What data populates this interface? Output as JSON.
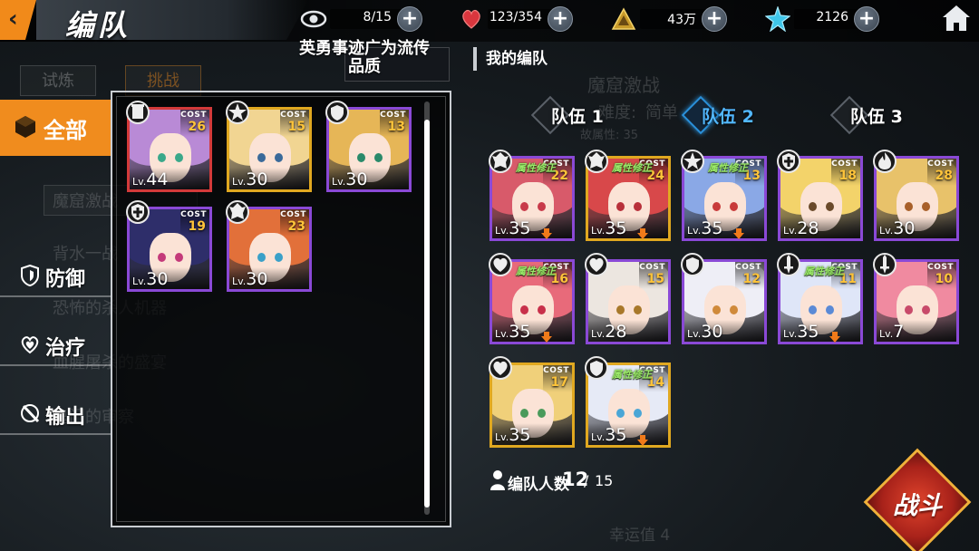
{
  "header": {
    "back_icon": "back-arrow-icon",
    "title": "编队",
    "resources": [
      {
        "icon": "eye-icon",
        "value": "8/15",
        "color": "#d8dde3"
      },
      {
        "icon": "heart-icon",
        "value": "123/354",
        "color": "#e2454e"
      },
      {
        "icon": "coin-triangle-icon",
        "value": "43万",
        "color": "#e2b437"
      },
      {
        "icon": "star-crystal-icon",
        "value": "2126",
        "color": "#4fd2f0"
      }
    ],
    "plus_label": "+",
    "home_icon": "home-icon"
  },
  "sidebar": {
    "categories": [
      {
        "label": "全部",
        "icon": "cube-icon",
        "active": true
      },
      {
        "label": "防御",
        "icon": "shield-icon",
        "active": false
      },
      {
        "label": "治疗",
        "icon": "heart-outline-icon",
        "active": false
      },
      {
        "label": "输出",
        "icon": "slash-icon",
        "active": false
      }
    ]
  },
  "background": {
    "tabs": [
      "试炼",
      "挑战"
    ],
    "items": [
      "魔窟激战",
      "背水一战",
      "恐怖的杀人机器",
      "血腥屠杀的盛宴",
      "鬼门的审察"
    ],
    "difficulty_label": "难度:",
    "difficulty_value": "简单",
    "attr_label": "故属性: 35",
    "cave_title": "魔窟激战",
    "lucky_value": "幸运值 4"
  },
  "notice": {
    "text": "英勇事迹广为流传",
    "quality_label": "品质"
  },
  "roster": {
    "cards": [
      {
        "name": "roster-card-1",
        "cost": 26,
        "level": 44,
        "rarity": "red",
        "hair": "#b98ad6",
        "eye": "#3aa88a",
        "badge": "tower-badge"
      },
      {
        "name": "roster-card-2",
        "cost": 15,
        "level": 30,
        "rarity": "gold",
        "hair": "#f1d592",
        "eye": "#3a6a9a",
        "badge": "star-badge"
      },
      {
        "name": "roster-card-3",
        "cost": 13,
        "level": 30,
        "rarity": "purple",
        "hair": "#e6b657",
        "eye": "#2a8a6a",
        "badge": "shield-wing-badge"
      },
      {
        "name": "roster-card-4",
        "cost": 19,
        "level": 30,
        "rarity": "purple",
        "hair": "#2e2e6a",
        "eye": "#c43a7a",
        "badge": "cross-shield-badge"
      },
      {
        "name": "roster-card-5",
        "cost": 23,
        "level": 30,
        "rarity": "purple",
        "hair": "#e2703a",
        "eye": "#3aa0c8",
        "badge": "crest-badge"
      }
    ]
  },
  "team": {
    "title": "我的编队",
    "tabs": [
      {
        "label": "队伍 1",
        "active": false
      },
      {
        "label": "队伍 2",
        "active": true
      },
      {
        "label": "队伍 3",
        "active": false
      }
    ],
    "attr_tag": "属性修正",
    "cost_label": "COST",
    "lv_label": "Lv.",
    "cards": [
      {
        "cost": 22,
        "level": 35,
        "rarity": "purple",
        "hair": "#d85a6a",
        "eye": "#c83a4a",
        "attr": true,
        "down": true,
        "badge": "crest-badge"
      },
      {
        "cost": 24,
        "level": 35,
        "rarity": "gold",
        "hair": "#d8484a",
        "eye": "#b8303a",
        "attr": true,
        "down": true,
        "badge": "crest-badge"
      },
      {
        "cost": 13,
        "level": 35,
        "rarity": "purple",
        "hair": "#8aa8e6",
        "eye": "#c83a3a",
        "attr": true,
        "down": true,
        "badge": "star-badge"
      },
      {
        "cost": 18,
        "level": 28,
        "rarity": "purple",
        "hair": "#f3d36a",
        "eye": "#6a4a2a",
        "attr": false,
        "down": false,
        "badge": "cross-shield-badge"
      },
      {
        "cost": 28,
        "level": 30,
        "rarity": "purple",
        "hair": "#e8c26a",
        "eye": "#a8602a",
        "attr": false,
        "down": false,
        "badge": "flame-badge"
      },
      {
        "cost": 16,
        "level": 35,
        "rarity": "purple",
        "hair": "#e86a7a",
        "eye": "#c8304a",
        "attr": true,
        "down": true,
        "badge": "heart-badge"
      },
      {
        "cost": 15,
        "level": 28,
        "rarity": "purple",
        "hair": "#ece6e0",
        "eye": "#a8782a",
        "attr": false,
        "down": false,
        "badge": "heart-badge"
      },
      {
        "cost": 12,
        "level": 30,
        "rarity": "purple",
        "hair": "#eeeef6",
        "eye": "#d08a3a",
        "attr": false,
        "down": false,
        "badge": "shield-wing-badge"
      },
      {
        "cost": 11,
        "level": 35,
        "rarity": "purple",
        "hair": "#dfe6f8",
        "eye": "#5a8ad6",
        "attr": true,
        "down": true,
        "badge": "sword-badge"
      },
      {
        "cost": 10,
        "level": 7,
        "rarity": "purple",
        "hair": "#f08aa0",
        "eye": "#c84a6a",
        "attr": false,
        "down": false,
        "badge": "sword-badge"
      },
      {
        "cost": 17,
        "level": 35,
        "rarity": "gold",
        "hair": "#f0d07a",
        "eye": "#4a9a5a",
        "attr": false,
        "down": false,
        "badge": "heart-badge"
      },
      {
        "cost": 14,
        "level": 35,
        "rarity": "gold",
        "hair": "#e6eaf6",
        "eye": "#4aa6d6",
        "attr": true,
        "down": true,
        "badge": "shield-wing-badge"
      }
    ],
    "count_label": "编队人数",
    "count_current": "12",
    "count_sep": "/",
    "count_max": "15"
  },
  "battle_button": {
    "label": "战斗"
  }
}
